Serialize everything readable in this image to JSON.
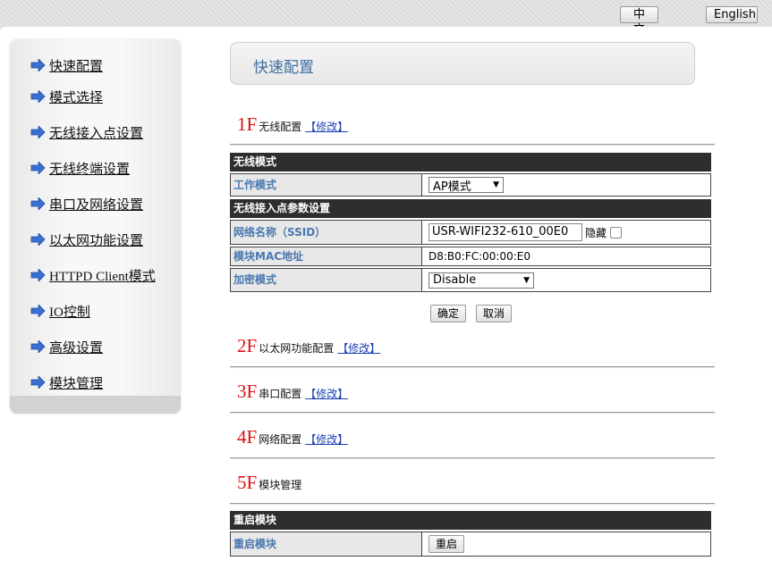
{
  "lang": {
    "zh": "中文",
    "en": "English"
  },
  "sidebar": {
    "items": [
      {
        "label": "快速配置"
      },
      {
        "label": "模式选择"
      },
      {
        "label": "无线接入点设置"
      },
      {
        "label": "无线终端设置"
      },
      {
        "label": "串口及网络设置"
      },
      {
        "label": "以太网功能设置"
      },
      {
        "label": "HTTPD Client模式"
      },
      {
        "label": "IO控制"
      },
      {
        "label": "高级设置"
      },
      {
        "label": "模块管理"
      }
    ]
  },
  "header": {
    "title": "快速配置"
  },
  "sections": [
    {
      "num": "1F",
      "title": "无线配置",
      "edit": "【修改】"
    },
    {
      "num": "2F",
      "title": "以太网功能配置",
      "edit": "【修改】"
    },
    {
      "num": "3F",
      "title": "串口配置",
      "edit": "【修改】"
    },
    {
      "num": "4F",
      "title": "网络配置",
      "edit": "【修改】"
    },
    {
      "num": "5F",
      "title": "模块管理",
      "edit": ""
    }
  ],
  "wireless": {
    "mode_header": "无线模式",
    "work_mode_label": "工作模式",
    "work_mode_value": "AP模式",
    "ap_header": "无线接入点参数设置",
    "ssid_label": "网络名称（SSID）",
    "ssid_value": "USR-WIFI232-610_00E0",
    "hide_label": "隐藏",
    "mac_label": "模块MAC地址",
    "mac_value": "D8:B0:FC:00:00:E0",
    "enc_label": "加密模式",
    "enc_value": "Disable",
    "confirm": "确定",
    "cancel": "取消"
  },
  "reboot": {
    "header": "重启模块",
    "label": "重启模块",
    "button": "重启"
  },
  "colors": {
    "arrow": "#3a6fd0",
    "section_number": "#dd1111",
    "label_blue": "#4a77b0",
    "table_header": "#2e2e2e"
  }
}
